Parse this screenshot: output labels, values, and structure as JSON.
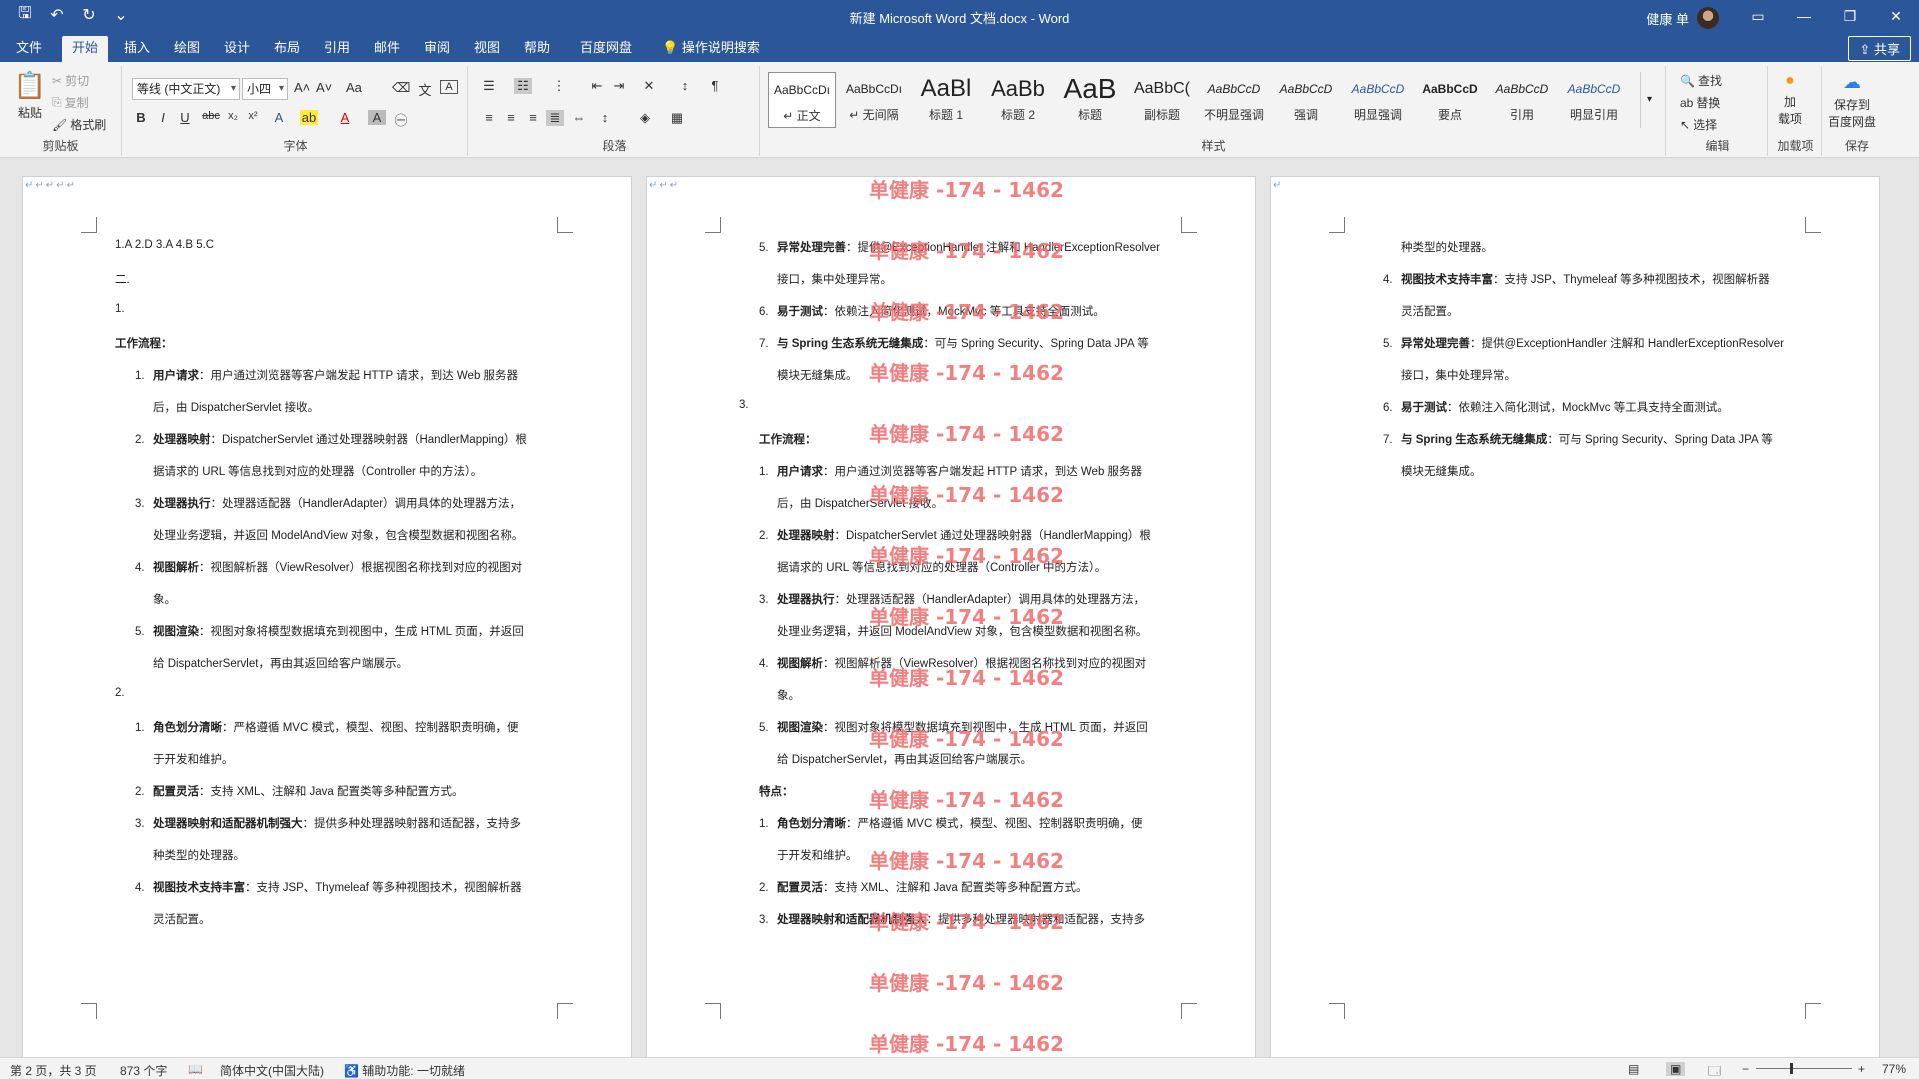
{
  "titlebar": {
    "doc_title": "新建 Microsoft Word 文档.docx  -  Word",
    "user_name": "健康 单",
    "qat_save": "🖫",
    "qat_undo": "↶",
    "qat_redo": "↻",
    "qat_more": "⌄"
  },
  "tabs": {
    "file": "文件",
    "home": "开始",
    "insert": "插入",
    "draw": "绘图",
    "design": "设计",
    "layout": "布局",
    "references": "引用",
    "mailings": "邮件",
    "review": "审阅",
    "view": "视图",
    "help": "帮助",
    "baidu": "百度网盘",
    "tellme": "操作说明搜索",
    "share": "共享"
  },
  "ribbon": {
    "clipboard": {
      "paste": "粘贴",
      "cut": "剪切",
      "copy": "复制",
      "painter": "格式刷",
      "label": "剪贴板"
    },
    "font": {
      "family": "等线 (中文正文)",
      "size": "小四",
      "label": "字体",
      "aa_grow": "A˄",
      "aa_shrink": "A˅",
      "case": "Aa"
    },
    "paragraph": {
      "label": "段落"
    },
    "styles": {
      "label": "样式",
      "items": [
        {
          "sample": "AaBbCcDı",
          "name": "↵ 正文"
        },
        {
          "sample": "AaBbCcDı",
          "name": "↵ 无间隔"
        },
        {
          "sample": "AaBl",
          "name": "标题 1"
        },
        {
          "sample": "AaBb",
          "name": "标题 2"
        },
        {
          "sample": "AaB",
          "name": "标题"
        },
        {
          "sample": "AaBbC(",
          "name": "副标题"
        },
        {
          "sample": "AaBbCcD",
          "name": "不明显强调"
        },
        {
          "sample": "AaBbCcD",
          "name": "强调"
        },
        {
          "sample": "AaBbCcD",
          "name": "明显强调"
        },
        {
          "sample": "AaBbCcD",
          "name": "要点"
        },
        {
          "sample": "AaBbCcD",
          "name": "引用"
        },
        {
          "sample": "AaBbCcD",
          "name": "明显引用"
        }
      ]
    },
    "editing": {
      "find": "查找",
      "replace": "替换",
      "select": "选择",
      "label": "编辑"
    },
    "addin": {
      "btn": "加\n载项",
      "label": "加载项"
    },
    "save": {
      "btn": "保存到\n百度网盘",
      "label": "保存"
    }
  },
  "watermark": "单健康 -174 - 1462",
  "page1": {
    "l1": "1.A 2.D 3.A 4.B 5.C",
    "l2": "二.",
    "l3": "1.",
    "l4": "工作流程：",
    "items": [
      {
        "n": "1.",
        "b": "用户请求",
        "t": "：用户通过浏览器等客户端发起 HTTP 请求，到达 Web 服务器",
        "t2": "后，由 DispatcherServlet 接收。"
      },
      {
        "n": "2.",
        "b": "处理器映射",
        "t": "：DispatcherServlet 通过处理器映射器（HandlerMapping）根",
        "t2": "据请求的 URL 等信息找到对应的处理器（Controller 中的方法）。"
      },
      {
        "n": "3.",
        "b": "处理器执行",
        "t": "：处理器适配器（HandlerAdapter）调用具体的处理器方法，",
        "t2": "处理业务逻辑，并返回 ModelAndView 对象，包含模型数据和视图名称。"
      },
      {
        "n": "4.",
        "b": "视图解析",
        "t": "：视图解析器（ViewResolver）根据视图名称找到对应的视图对",
        "t2": "象。"
      },
      {
        "n": "5.",
        "b": "视图渲染",
        "t": "：视图对象将模型数据填充到视图中，生成 HTML 页面，并返回",
        "t2": "给 DispatcherServlet，再由其返回给客户端展示。"
      }
    ],
    "l5": "2.",
    "items2": [
      {
        "n": "1.",
        "b": "角色划分清晰",
        "t": "：严格遵循 MVC 模式，模型、视图、控制器职责明确，便",
        "t2": "于开发和维护。"
      },
      {
        "n": "2.",
        "b": "配置灵活",
        "t": "：支持 XML、注解和 Java 配置类等多种配置方式。",
        "t2": ""
      },
      {
        "n": "3.",
        "b": "处理器映射和适配器机制强大",
        "t": "：提供多种处理器映射器和适配器，支持多",
        "t2": "种类型的处理器。"
      },
      {
        "n": "4.",
        "b": "视图技术支持丰富",
        "t": "：支持 JSP、Thymeleaf 等多种视图技术，视图解析器",
        "t2": "灵活配置。"
      }
    ]
  },
  "page2": {
    "items": [
      {
        "n": "5.",
        "b": "异常处理完善",
        "t": "：提供@ExceptionHandler 注解和 HandlerExceptionResolver",
        "t2": "接口，集中处理异常。"
      },
      {
        "n": "6.",
        "b": "易于测试",
        "t": "：依赖注入简化测试，MockMvc 等工具支持全面测试。",
        "t2": ""
      },
      {
        "n": "7.",
        "b": "与 Spring 生态系统无缝集成",
        "t": "：可与 Spring Security、Spring Data JPA 等",
        "t2": "模块无缝集成。"
      }
    ],
    "l3": "3.",
    "l4": "工作流程：",
    "flow": [
      {
        "n": "1.",
        "b": "用户请求",
        "t": "：用户通过浏览器等客户端发起 HTTP 请求，到达 Web 服务器",
        "t2": "后，由 DispatcherServlet 接收。"
      },
      {
        "n": "2.",
        "b": "处理器映射",
        "t": "：DispatcherServlet 通过处理器映射器（HandlerMapping）根",
        "t2": "据请求的 URL 等信息找到对应的处理器（Controller 中的方法）。"
      },
      {
        "n": "3.",
        "b": "处理器执行",
        "t": "：处理器适配器（HandlerAdapter）调用具体的处理器方法，",
        "t2": "处理业务逻辑，并返回 ModelAndView 对象，包含模型数据和视图名称。"
      },
      {
        "n": "4.",
        "b": "视图解析",
        "t": "：视图解析器（ViewResolver）根据视图名称找到对应的视图对",
        "t2": "象。"
      },
      {
        "n": "5.",
        "b": "视图渲染",
        "t": "：视图对象将模型数据填充到视图中，生成 HTML 页面，并返回",
        "t2": "给 DispatcherServlet，再由其返回给客户端展示。"
      }
    ],
    "l5": "特点：",
    "feat": [
      {
        "n": "1.",
        "b": "角色划分清晰",
        "t": "：严格遵循 MVC 模式，模型、视图、控制器职责明确，便",
        "t2": "于开发和维护。"
      },
      {
        "n": "2.",
        "b": "配置灵活",
        "t": "：支持 XML、注解和 Java 配置类等多种配置方式。",
        "t2": ""
      },
      {
        "n": "3.",
        "b": "处理器映射和适配器机制强大",
        "t": "：提供多种处理器映射器和适配器，支持多",
        "t2": ""
      }
    ]
  },
  "page3": {
    "l0": "种类型的处理器。",
    "items": [
      {
        "n": "4.",
        "b": "视图技术支持丰富",
        "t": "：支持 JSP、Thymeleaf 等多种视图技术，视图解析器",
        "t2": "灵活配置。"
      },
      {
        "n": "5.",
        "b": "异常处理完善",
        "t": "：提供@ExceptionHandler 注解和 HandlerExceptionResolver",
        "t2": "接口，集中处理异常。"
      },
      {
        "n": "6.",
        "b": "易于测试",
        "t": "：依赖注入简化测试，MockMvc 等工具支持全面测试。",
        "t2": ""
      },
      {
        "n": "7.",
        "b": "与 Spring 生态系统无缝集成",
        "t": "：可与 Spring Security、Spring Data JPA 等",
        "t2": "模块无缝集成。"
      }
    ]
  },
  "statusbar": {
    "page": "第 2 页，共 3 页",
    "words": "873 个字",
    "lang": "简体中文(中国大陆)",
    "access": "辅助功能: 一切就绪",
    "zoom": "77%",
    "zoom_minus": "−",
    "zoom_plus": "+"
  },
  "colors": {
    "accent": "#2b579a",
    "watermark": "#f06a6a"
  }
}
